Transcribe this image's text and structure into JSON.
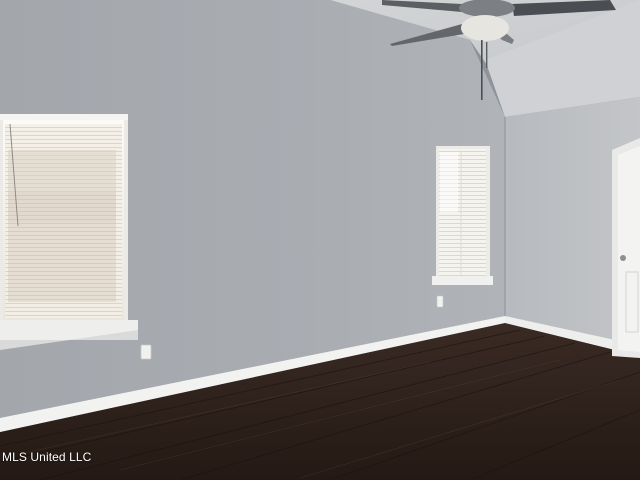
{
  "photo": {
    "watermark_text": "MLS United LLC"
  },
  "colors": {
    "wall": "#a9adb2",
    "ceiling": "#c9cbce",
    "floor": "#2a1e19",
    "trim": "#f2f2f0",
    "window_light": "#f4f1ea"
  },
  "objects": {
    "window_left": "window",
    "window_right": "window",
    "ceiling_fan": "ceiling-fan-icon",
    "door": "door",
    "outlets": "electrical-outlet"
  }
}
